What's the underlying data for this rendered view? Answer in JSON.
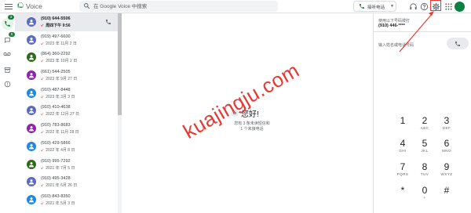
{
  "header": {
    "brand": "Voice",
    "search_placeholder": "在 Google Voice 中搜索",
    "call_button_label": "接听电话",
    "dropdown_glyph": "▼"
  },
  "rail": {
    "badges": [
      "3",
      "5"
    ]
  },
  "list": {
    "items": [
      {
        "number": "(910) 644-5506",
        "date": "周四下午 9:56",
        "color": "#5c6bc0",
        "selected": true
      },
      {
        "number": "(919) 497-6600",
        "date": "2023 年 11月 2 日",
        "color": "#5c6bc0"
      },
      {
        "number": "(864) 360-2292",
        "date": "2023 年 10月 2 日",
        "color": "#33691e"
      },
      {
        "number": "(661) 544-2505",
        "date": "2023 年 9月 27 日",
        "color": "#8e24aa"
      },
      {
        "number": "(910) 487-8448",
        "date": "2023 年 3月 3 日",
        "color": "#1e88e5"
      },
      {
        "number": "(910) 410-4638",
        "date": "2022 年 12月 27 日",
        "color": "#5c6bc0"
      },
      {
        "number": "(910) 783-8683",
        "date": "2022 年 11月 28 日",
        "color": "#8e24aa"
      },
      {
        "number": "(910) 429-5866",
        "date": "2022 年 4月 8 日",
        "color": "#1e88e5"
      },
      {
        "number": "(910) 995-7292",
        "date": "2021 年 7月 5 日",
        "color": "#33691e"
      },
      {
        "number": "(910) 495-3428",
        "date": "2021 年 6月 26 日",
        "color": "#5c6bc0"
      },
      {
        "number": "(910) 843-8350",
        "date": "2021 年 5月 3 日",
        "color": "#1e88e5"
      }
    ]
  },
  "center": {
    "greeting": "您好!",
    "line1": "您有 3 条未读短信和",
    "line2": "1 个未接电话"
  },
  "watermark": "kuajingju.com",
  "dialer": {
    "from_label": "使用以下号码拨打",
    "from_number": "(910) 446-****",
    "to_placeholder": "输入姓名或电话号码",
    "keys": [
      {
        "digit": "1",
        "letters": ""
      },
      {
        "digit": "2",
        "letters": "ABC"
      },
      {
        "digit": "3",
        "letters": "DEF"
      },
      {
        "digit": "4",
        "letters": "GHI"
      },
      {
        "digit": "5",
        "letters": "JKL"
      },
      {
        "digit": "6",
        "letters": "MNO"
      },
      {
        "digit": "7",
        "letters": "PQRS"
      },
      {
        "digit": "8",
        "letters": "TUV"
      },
      {
        "digit": "9",
        "letters": "WXYZ"
      },
      {
        "digit": "*",
        "letters": ""
      },
      {
        "digit": "0",
        "letters": "+"
      },
      {
        "digit": "#",
        "letters": ""
      }
    ]
  },
  "colors": {
    "accent_green": "#188038",
    "highlight_red": "#e53935"
  }
}
